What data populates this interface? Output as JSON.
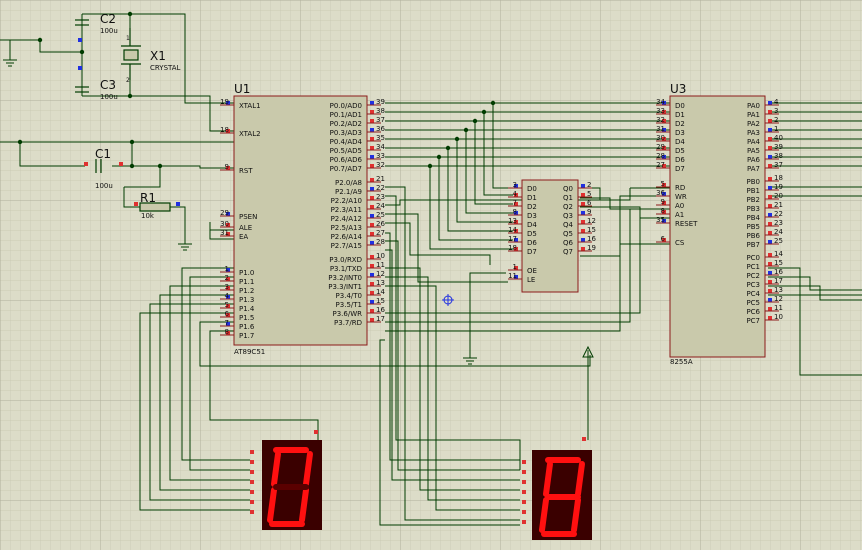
{
  "colors": {
    "bg": "#dcdcc8",
    "grid": "#c6c6b0",
    "grid_major": "#b4b4a0",
    "chip": "#c9c9ab",
    "chip_border": "#8b1a1a",
    "wire": "#003c00",
    "pin_red": "#e03030",
    "pin_blue": "#2030e0",
    "text": "#101010",
    "seg_on": "#ff1010",
    "seg_off": "#5a0000",
    "seg_body": "#3a0000"
  },
  "components": {
    "u1": {
      "ref": "U1",
      "part": "AT89C51",
      "left_pins": [
        {
          "num": "19",
          "name": "XTAL1"
        },
        {
          "num": "18",
          "name": "XTAL2"
        },
        {
          "num": "9",
          "name": "RST"
        },
        {
          "num": "29",
          "name": "PSEN"
        },
        {
          "num": "30",
          "name": "ALE"
        },
        {
          "num": "31",
          "name": "EA"
        },
        {
          "num": "1",
          "name": "P1.0"
        },
        {
          "num": "2",
          "name": "P1.1"
        },
        {
          "num": "3",
          "name": "P1.2"
        },
        {
          "num": "4",
          "name": "P1.3"
        },
        {
          "num": "5",
          "name": "P1.4"
        },
        {
          "num": "6",
          "name": "P1.5"
        },
        {
          "num": "7",
          "name": "P1.6"
        },
        {
          "num": "8",
          "name": "P1.7"
        }
      ],
      "right_pins": [
        {
          "num": "39",
          "name": "P0.0/AD0"
        },
        {
          "num": "38",
          "name": "P0.1/AD1"
        },
        {
          "num": "37",
          "name": "P0.2/AD2"
        },
        {
          "num": "36",
          "name": "P0.3/AD3"
        },
        {
          "num": "35",
          "name": "P0.4/AD4"
        },
        {
          "num": "34",
          "name": "P0.5/AD5"
        },
        {
          "num": "33",
          "name": "P0.6/AD6"
        },
        {
          "num": "32",
          "name": "P0.7/AD7"
        },
        {
          "num": "21",
          "name": "P2.0/A8"
        },
        {
          "num": "22",
          "name": "P2.1/A9"
        },
        {
          "num": "23",
          "name": "P2.2/A10"
        },
        {
          "num": "24",
          "name": "P2.3/A11"
        },
        {
          "num": "25",
          "name": "P2.4/A12"
        },
        {
          "num": "26",
          "name": "P2.5/A13"
        },
        {
          "num": "27",
          "name": "P2.6/A14"
        },
        {
          "num": "28",
          "name": "P2.7/A15"
        },
        {
          "num": "10",
          "name": "P3.0/RXD"
        },
        {
          "num": "11",
          "name": "P3.1/TXD"
        },
        {
          "num": "12",
          "name": "P3.2/INT0"
        },
        {
          "num": "13",
          "name": "P3.3/INT1"
        },
        {
          "num": "14",
          "name": "P3.4/T0"
        },
        {
          "num": "15",
          "name": "P3.5/T1"
        },
        {
          "num": "16",
          "name": "P3.6/WR"
        },
        {
          "num": "17",
          "name": "P3.7/RD"
        }
      ]
    },
    "u2": {
      "left_pins": [
        {
          "num": "3",
          "name": "D0"
        },
        {
          "num": "4",
          "name": "D1"
        },
        {
          "num": "7",
          "name": "D2"
        },
        {
          "num": "8",
          "name": "D3"
        },
        {
          "num": "13",
          "name": "D4"
        },
        {
          "num": "14",
          "name": "D5"
        },
        {
          "num": "17",
          "name": "D6"
        },
        {
          "num": "18",
          "name": "D7"
        },
        {
          "num": "1",
          "name": "OE"
        },
        {
          "num": "11",
          "name": "LE"
        }
      ],
      "right_pins": [
        {
          "num": "2",
          "name": "Q0"
        },
        {
          "num": "5",
          "name": "Q1"
        },
        {
          "num": "6",
          "name": "Q2"
        },
        {
          "num": "9",
          "name": "Q3"
        },
        {
          "num": "12",
          "name": "Q4"
        },
        {
          "num": "15",
          "name": "Q5"
        },
        {
          "num": "16",
          "name": "Q6"
        },
        {
          "num": "19",
          "name": "Q7"
        }
      ]
    },
    "u3": {
      "ref": "U3",
      "part": "8255A",
      "left_pins": [
        {
          "num": "34",
          "name": "D0"
        },
        {
          "num": "33",
          "name": "D1"
        },
        {
          "num": "32",
          "name": "D2"
        },
        {
          "num": "31",
          "name": "D3"
        },
        {
          "num": "30",
          "name": "D4"
        },
        {
          "num": "29",
          "name": "D5"
        },
        {
          "num": "28",
          "name": "D6"
        },
        {
          "num": "27",
          "name": "D7"
        },
        {
          "num": "5",
          "name": "RD"
        },
        {
          "num": "36",
          "name": "WR"
        },
        {
          "num": "9",
          "name": "A0"
        },
        {
          "num": "8",
          "name": "A1"
        },
        {
          "num": "35",
          "name": "RESET"
        },
        {
          "num": "6",
          "name": "CS"
        }
      ],
      "right_pins": [
        {
          "num": "4",
          "name": "PA0"
        },
        {
          "num": "3",
          "name": "PA1"
        },
        {
          "num": "2",
          "name": "PA2"
        },
        {
          "num": "1",
          "name": "PA3"
        },
        {
          "num": "40",
          "name": "PA4"
        },
        {
          "num": "39",
          "name": "PA5"
        },
        {
          "num": "38",
          "name": "PA6"
        },
        {
          "num": "37",
          "name": "PA7"
        },
        {
          "num": "18",
          "name": "PB0"
        },
        {
          "num": "19",
          "name": "PB1"
        },
        {
          "num": "20",
          "name": "PB2"
        },
        {
          "num": "21",
          "name": "PB3"
        },
        {
          "num": "22",
          "name": "PB4"
        },
        {
          "num": "23",
          "name": "PB5"
        },
        {
          "num": "24",
          "name": "PB6"
        },
        {
          "num": "25",
          "name": "PB7"
        },
        {
          "num": "14",
          "name": "PC0"
        },
        {
          "num": "15",
          "name": "PC1"
        },
        {
          "num": "16",
          "name": "PC2"
        },
        {
          "num": "17",
          "name": "PC3"
        },
        {
          "num": "13",
          "name": "PC4"
        },
        {
          "num": "12",
          "name": "PC5"
        },
        {
          "num": "11",
          "name": "PC6"
        },
        {
          "num": "10",
          "name": "PC7"
        }
      ]
    },
    "c1": {
      "ref": "C1",
      "value": "100u"
    },
    "c2": {
      "ref": "C2",
      "value": "100u",
      "pins": [
        "1",
        "2"
      ]
    },
    "c3": {
      "ref": "C3",
      "value": "100u"
    },
    "x1": {
      "ref": "X1",
      "value": "CRYSTAL"
    },
    "r1": {
      "ref": "R1",
      "value": "10k"
    },
    "display_left": {
      "digit": "0",
      "segments": [
        "a",
        "b",
        "c",
        "d",
        "e",
        "f"
      ]
    },
    "display_right": {
      "digit": "8",
      "segments": [
        "a",
        "b",
        "c",
        "d",
        "e",
        "f",
        "g"
      ]
    }
  }
}
